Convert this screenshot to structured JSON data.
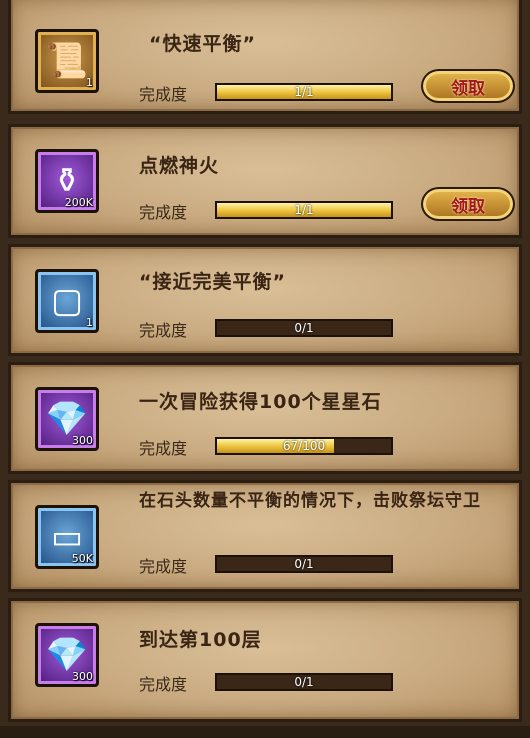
{
  "claim_label": "领取",
  "progress_label": "完成度",
  "achievements": [
    {
      "title": "“快速平衡”",
      "icon": "scroll-icon",
      "count": "1",
      "progress_text": "1/1",
      "progress": 1.0,
      "claimable": true
    },
    {
      "title": "点燃神火",
      "icon": "potion-icon",
      "count": "200K",
      "progress_text": "1/1",
      "progress": 1.0,
      "claimable": true
    },
    {
      "title": "“接近完美平衡”",
      "icon": "frame-icon",
      "count": "1",
      "progress_text": "0/1",
      "progress": 0.0,
      "claimable": false
    },
    {
      "title": "一次冒险获得100个星星石",
      "icon": "diamond-icon",
      "count": "300",
      "progress_text": "67/100",
      "progress": 0.67,
      "claimable": false
    },
    {
      "title": "在石头数量不平衡的情况下，击败祭坛守卫",
      "icon": "silver-bar-icon",
      "count": "50K",
      "progress_text": "0/1",
      "progress": 0.0,
      "claimable": false
    },
    {
      "title": "到达第100层",
      "icon": "diamond-icon",
      "count": "300",
      "progress_text": "0/1",
      "progress": 0.0,
      "claimable": false
    }
  ]
}
